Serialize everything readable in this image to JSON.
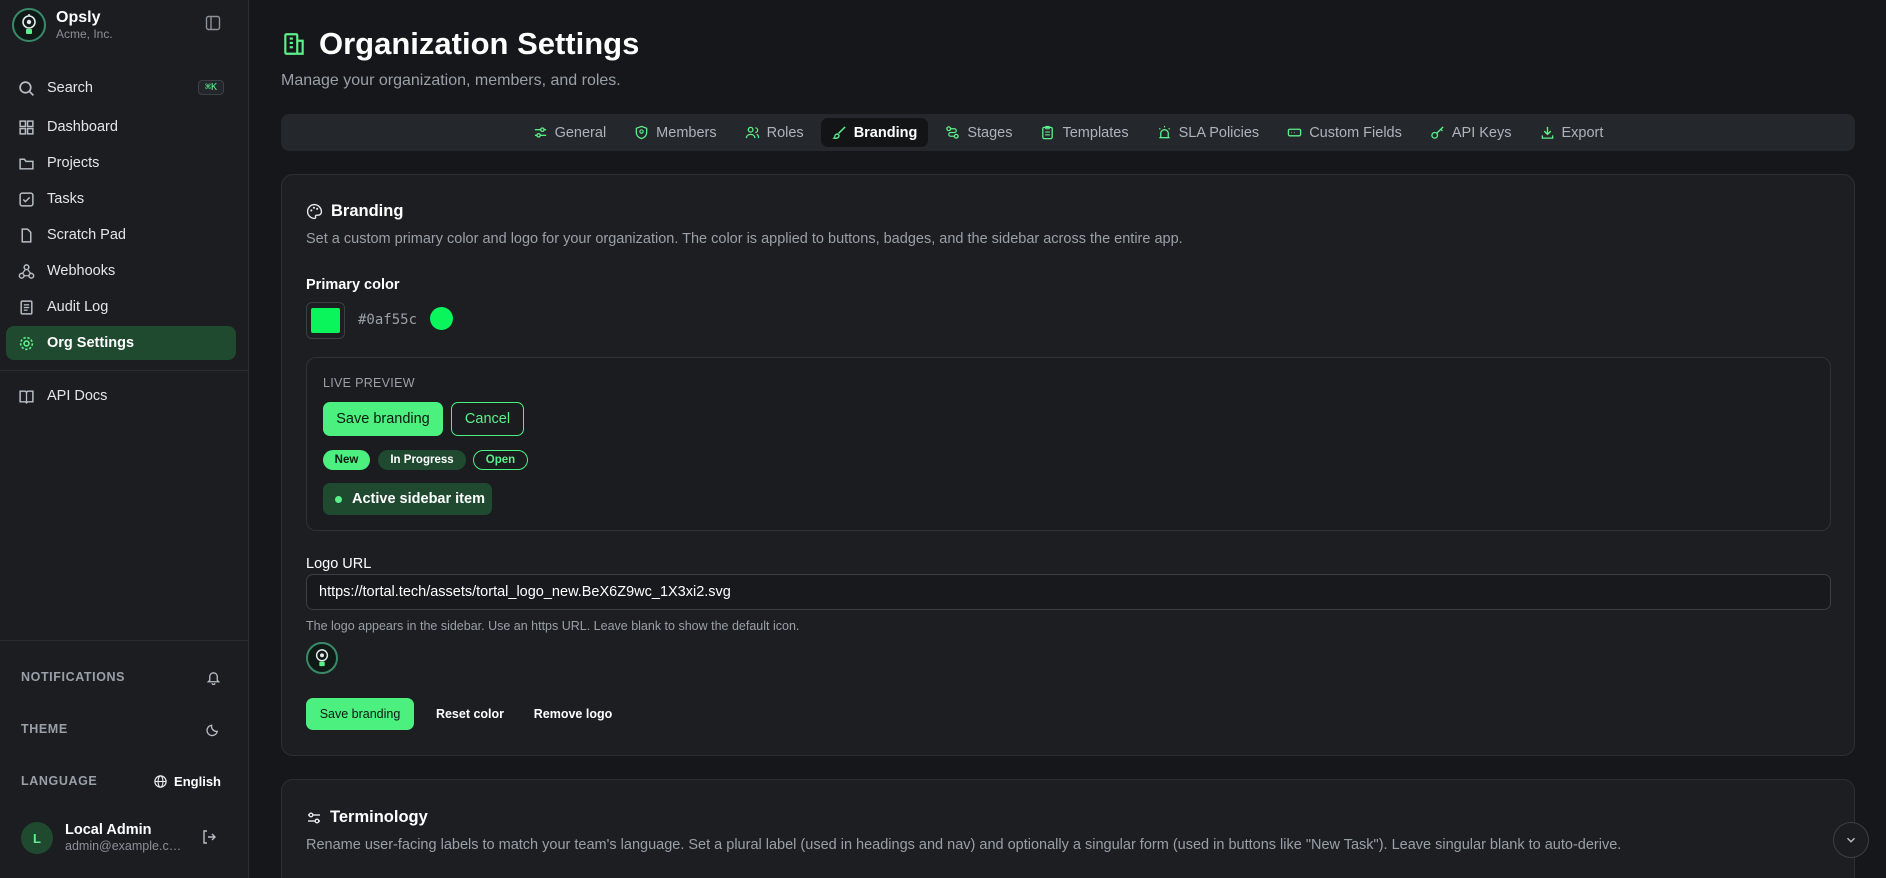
{
  "app": {
    "name": "Opsly",
    "org": "Acme, Inc."
  },
  "sidebar": {
    "search": {
      "label": "Search",
      "shortcut": "⌘K"
    },
    "items": [
      {
        "label": "Dashboard",
        "icon": "dashboard-icon"
      },
      {
        "label": "Projects",
        "icon": "projects-icon"
      },
      {
        "label": "Tasks",
        "icon": "tasks-icon"
      },
      {
        "label": "Scratch Pad",
        "icon": "file-icon"
      },
      {
        "label": "Webhooks",
        "icon": "webhook-icon"
      },
      {
        "label": "Audit Log",
        "icon": "log-icon"
      },
      {
        "label": "Org Settings",
        "icon": "gear-icon",
        "active": true
      }
    ],
    "api_docs": "API Docs",
    "notifications_label": "NOTIFICATIONS",
    "theme_label": "THEME",
    "language_label": "LANGUAGE",
    "language_value": "English",
    "user": {
      "initial": "L",
      "name": "Local Admin",
      "email": "admin@example.com"
    }
  },
  "page": {
    "title": "Organization Settings",
    "subtitle": "Manage your organization, members, and roles."
  },
  "tabs": [
    {
      "label": "General"
    },
    {
      "label": "Members"
    },
    {
      "label": "Roles"
    },
    {
      "label": "Branding",
      "active": true
    },
    {
      "label": "Stages"
    },
    {
      "label": "Templates"
    },
    {
      "label": "SLA Policies"
    },
    {
      "label": "Custom Fields"
    },
    {
      "label": "API Keys"
    },
    {
      "label": "Export"
    }
  ],
  "branding": {
    "title": "Branding",
    "description": "Set a custom primary color and logo for your organization. The color is applied to buttons, badges, and the sidebar across the entire app.",
    "primary_color_label": "Primary color",
    "primary_color_value": "#0af55c",
    "preview": {
      "label": "LIVE PREVIEW",
      "save": "Save branding",
      "cancel": "Cancel",
      "badge_new": "New",
      "badge_progress": "In Progress",
      "badge_open": "Open",
      "sidebar_item": "Active sidebar item"
    },
    "logo_url_label": "Logo URL",
    "logo_url_value": "https://tortal.tech/assets/tortal_logo_new.BeX6Z9wc_1X3xi2.svg",
    "logo_hint": "The logo appears in the sidebar. Use an https URL. Leave blank to show the default icon.",
    "save_button": "Save branding",
    "reset_button": "Reset color",
    "remove_button": "Remove logo"
  },
  "terminology": {
    "title": "Terminology",
    "description": "Rename user-facing labels to match your team's language. Set a plural label (used in headings and nav) and optionally a singular form (used in buttons like \"New Task\"). Leave singular blank to auto-derive."
  },
  "colors": {
    "accent": "#4cf07f",
    "brand": "#0af55c",
    "active_bg": "#1f4a30"
  }
}
